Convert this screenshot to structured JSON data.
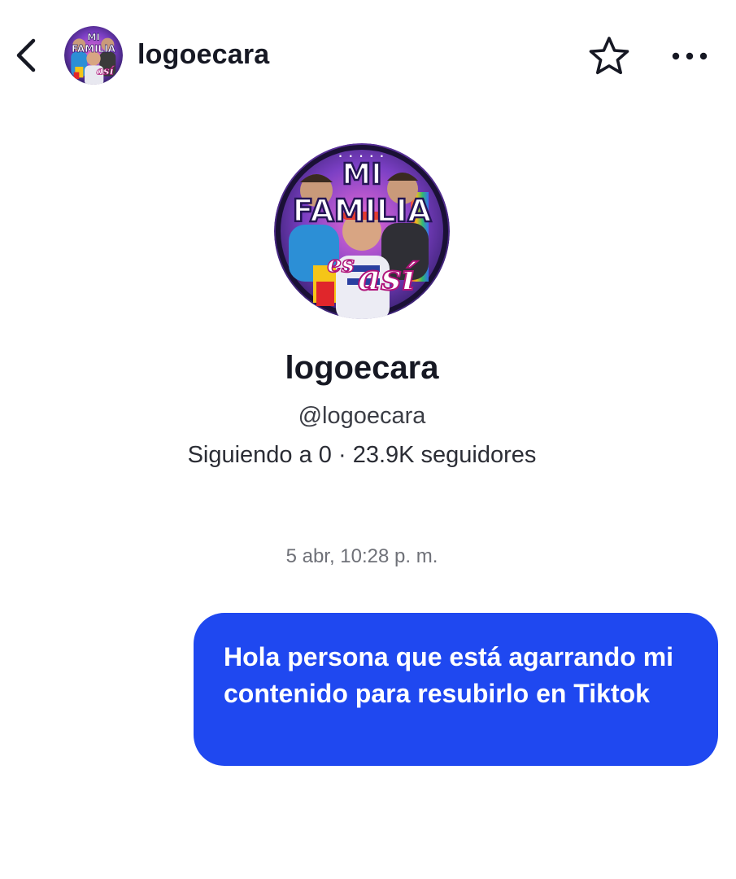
{
  "header": {
    "back_icon": "chevron-left-icon",
    "username": "logoecara",
    "favorite_icon": "star-outline-icon",
    "more_icon": "more-horizontal-icon"
  },
  "profile": {
    "avatar_logo_text": [
      "MI",
      "FAMILIA",
      "es",
      "así"
    ],
    "display_name": "logoecara",
    "handle": "@logoecara",
    "stats": "Siguiendo a 0 · 23.9K seguidores"
  },
  "conversation": {
    "timestamp": "5 abr, 10:28 p. m.",
    "messages": [
      {
        "sender": "me",
        "text": "Hola persona que está agarrando mi contenido para resubirlo en Tiktok",
        "bubble_color": "#1f48f0"
      }
    ]
  },
  "colors": {
    "accent_bubble": "#1f48f0",
    "text_primary": "#161823",
    "text_muted": "#6f7178"
  }
}
